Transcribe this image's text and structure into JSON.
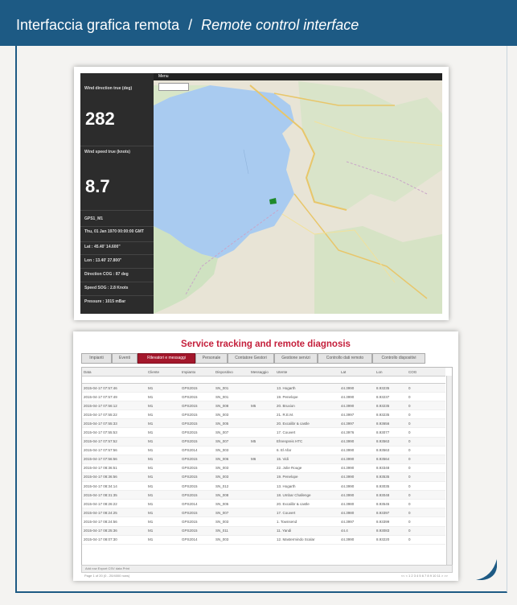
{
  "header": {
    "title_it": "Interfaccia grafica remota",
    "separator": "/",
    "title_en": "Remote control interface"
  },
  "dashboard": {
    "menu_label": "Menu",
    "wind_direction_label": "Wind direction true (deg)",
    "wind_direction_value": "282",
    "wind_speed_label": "Wind speed true (knots)",
    "wind_speed_value": "8.7",
    "gps_label": "GPS1_M1",
    "date": "Thu, 01 Jan 1970 00:00:00 GMT",
    "lat": "Lat : 45.40' 14.600\"",
    "lon": "Lon : 13.40' 27.800\"",
    "direction": "Direction COG : 87 deg",
    "speed": "Speed SOG : 2.8 Knots",
    "pressure": "Pressure : 1015 mBar"
  },
  "tracking": {
    "title": "Service tracking and remote diagnosis",
    "tabs": [
      "Impianti",
      "Eventi",
      "Rilevatori e messaggi",
      "Personale",
      "Contatore Gestori",
      "Gestione servizi",
      "Controllo dati remoto",
      "Controllo dispositivi"
    ],
    "active_tab_index": 2,
    "columns": [
      "Data",
      "Cliente",
      "Impianto",
      "Dispositivo",
      "Messaggio",
      "Utente",
      "Lat",
      "Lon",
      "COG"
    ],
    "rows": [
      [
        "2015-04-17 07:57:46",
        "M1",
        "GPS2015",
        "SN_001",
        "",
        "13. Hogarth",
        "44.3990",
        "8.93235",
        "0"
      ],
      [
        "2015-04-17 07:57:49",
        "M1",
        "GPS2015",
        "SN_001",
        "",
        "19. Penelope",
        "44.3990",
        "8.93237",
        "0"
      ],
      [
        "2015-04-17 07:56:12",
        "M1",
        "GPS2015",
        "SN_008",
        "M5",
        "20. Bruxion",
        "44.3990",
        "8.93235",
        "0"
      ],
      [
        "2015-04-17 07:55:22",
        "M1",
        "GPS2015",
        "SN_003",
        "",
        "21. R.E.M.",
        "44.3997",
        "8.93235",
        "0"
      ],
      [
        "2015-04-17 07:55:33",
        "M1",
        "GPS2015",
        "SN_005",
        "",
        "20. Excalibr & castle",
        "44.3997",
        "8.93656",
        "0"
      ],
      [
        "2015-04-17 07:55:53",
        "M1",
        "GPS2015",
        "SN_007",
        "",
        "17. Couvert",
        "44.3976",
        "8.93077",
        "0"
      ],
      [
        "2015-04-17 07:57:52",
        "M1",
        "GPS2015",
        "SN_007",
        "M5",
        "Ehrenpreis HTC",
        "44.3990",
        "8.93563",
        "0"
      ],
      [
        "2015-04-17 07:57:56",
        "M1",
        "GPS2014",
        "SN_003",
        "",
        "6. El Afar",
        "44.3990",
        "8.93563",
        "0"
      ],
      [
        "2015-04-17 07:56:56",
        "M1",
        "GPS2015",
        "SN_006",
        "M6",
        "15. Vidi",
        "44.3990",
        "8.93564",
        "0"
      ],
      [
        "2015-04-17 08:36:51",
        "M1",
        "GPS2015",
        "SN_003",
        "",
        "22. Jolie Rouge",
        "44.3990",
        "8.93348",
        "0"
      ],
      [
        "2015-04-17 08:36:56",
        "M1",
        "GPS2015",
        "SN_003",
        "",
        "19. Penelope",
        "44.3990",
        "8.93535",
        "0"
      ],
      [
        "2015-04-17 08:34:14",
        "M1",
        "GPS2015",
        "SN_012",
        "",
        "13. Hogarth",
        "44.3990",
        "8.93035",
        "0"
      ],
      [
        "2015-04-17 08:31:35",
        "M1",
        "GPS2015",
        "SN_008",
        "",
        "18. Umbar Challenge",
        "44.3990",
        "8.93048",
        "0"
      ],
      [
        "2015-04-17 08:26:22",
        "M1",
        "GPS2014",
        "SN_005",
        "",
        "20. Excalibr & castle",
        "44.3980",
        "8.93545",
        "0"
      ],
      [
        "2015-04-17 08:24:25",
        "M1",
        "GPS2015",
        "SN_007",
        "",
        "17. Couvert",
        "44.3980",
        "8.93397",
        "0"
      ],
      [
        "2015-04-17 08:24:56",
        "M1",
        "GPS2015",
        "SN_003",
        "",
        "1. Townsend",
        "44.3997",
        "8.93399",
        "0"
      ],
      [
        "2015-04-17 08:25:36",
        "M1",
        "GPS2015",
        "SN_011",
        "",
        "11. Yandi",
        "44.4",
        "8.93083",
        "0"
      ],
      [
        "2015-04-17 08:07:30",
        "M1",
        "GPS2014",
        "SN_003",
        "",
        "12. Mastermindo Scalar",
        "44.3990",
        "8.93220",
        "0"
      ]
    ],
    "toolbar": "Add row   Export CSV data   Print",
    "page_info": "Page 1 of 20 (0 - 20/4000 rows)",
    "pages": "<< < 1 2 3 4 5 6 7 8 9 10 11 > >>"
  }
}
